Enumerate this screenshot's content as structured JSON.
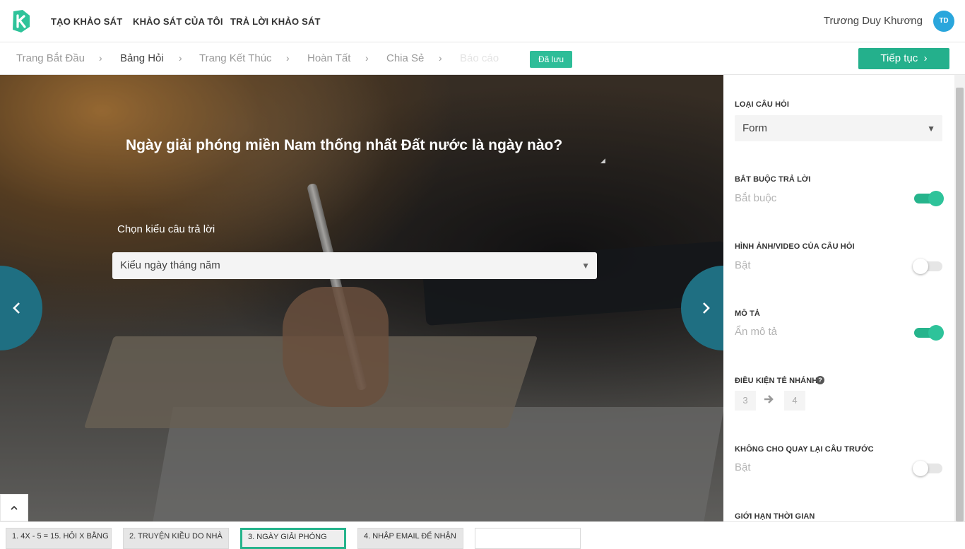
{
  "header": {
    "nav": [
      "TẠO KHẢO SÁT",
      "KHẢO SÁT CỦA TÔI",
      "TRẢ LỜI KHẢO SÁT"
    ],
    "user_name": "Trương Duy Khương",
    "avatar_initials": "TD"
  },
  "steps": {
    "items": [
      "Trang Bắt Đầu",
      "Bảng Hỏi",
      "Trang Kết Thúc",
      "Hoàn Tất",
      "Chia Sẻ",
      "Báo cáo"
    ],
    "active": "Bảng Hỏi",
    "saved_badge": "Đã lưu",
    "continue_label": "Tiếp tục"
  },
  "editor": {
    "question": "Ngày giải phóng miền Nam thống nhất Đất nước là ngày nào?",
    "answer_type_label": "Chọn kiểu câu trả lời",
    "answer_type_value": "Kiểu ngày tháng năm"
  },
  "panel": {
    "question_type_label": "LOẠI CÂU HỎI",
    "question_type_value": "Form",
    "required_label": "BẮT BUỘC TRẢ LỜI",
    "required_sub": "Bắt buộc",
    "required_on": true,
    "media_label": "HÌNH ẢNH/VIDEO CỦA CÂU HỎI",
    "media_sub": "Bật",
    "media_on": false,
    "description_label": "MÔ TẢ",
    "description_sub": "Ẩn mô tả",
    "description_on": true,
    "branch_label": "ĐIỀU KIỆN TẺ NHÁNH",
    "branch_from": "3",
    "branch_to": "4",
    "no_back_label": "KHÔNG CHO QUAY LẠI CÂU TRƯỚC",
    "no_back_sub": "Bật",
    "no_back_on": false,
    "time_limit_label": "GIỚI HẠN THỜI GIAN"
  },
  "question_tabs": [
    "1. 4X - 5 = 15. HỎI X BẰNG",
    "2. TRUYỆN KIỀU DO NHÀ",
    "3. NGÀY GIẢI PHÓNG",
    "4. NHẬP EMAIL ĐỂ NHẬN",
    ""
  ],
  "colors": {
    "accent": "#26b48c",
    "nav_circle": "#1f6f82",
    "avatar": "#2aa6dc"
  }
}
